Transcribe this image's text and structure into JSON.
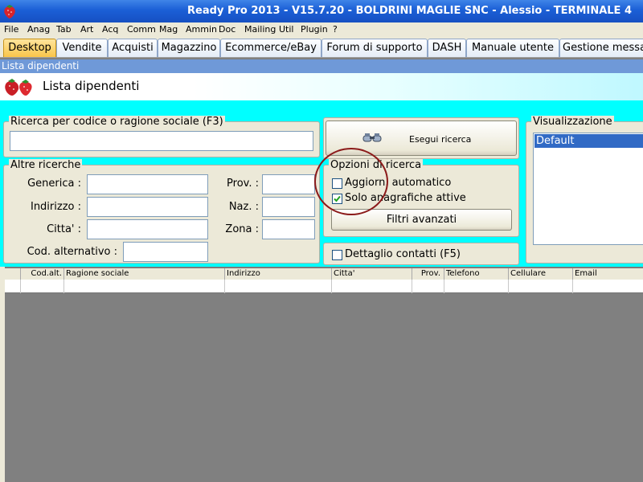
{
  "window": {
    "title": "Ready Pro 2013 - V15.7.20 - BOLDRINI MAGLIE SNC - Alessio - TERMINALE 4"
  },
  "menu": [
    "File",
    "Anag",
    "Tab",
    "Art",
    "Acq",
    "Comm",
    "Mag",
    "Ammin",
    "Doc",
    "Mailing",
    "Util",
    "Plugin",
    "?"
  ],
  "tabs": [
    "Desktop",
    "Vendite",
    "Acquisti",
    "Magazzino",
    "Ecommerce/eBay",
    "Forum di supporto",
    "DASH",
    "Manuale utente",
    "Gestione messa"
  ],
  "active_tab": "Desktop",
  "panel": {
    "caption": "Lista dipendenti",
    "title": "Lista dipendenti"
  },
  "search": {
    "group_label": "Ricerca per codice o ragione sociale (F3)",
    "value": "",
    "search_button": "Esegui ricerca"
  },
  "other_searches": {
    "group_label": "Altre ricerche",
    "fields": {
      "generica": "Generica :",
      "indirizzo": "Indirizzo :",
      "citta": "Citta' :",
      "cod_alt": "Cod. alternativo :",
      "prov": "Prov. :",
      "naz": "Naz. :",
      "zona": "Zona :"
    }
  },
  "options": {
    "group_label": "Opzioni di ricerca",
    "auto_update": {
      "label": "Aggiorn. automatico",
      "checked": false
    },
    "active_only": {
      "label": "Solo anagrafiche attive",
      "checked": true
    },
    "advanced_filters": "Filtri avanzati",
    "contact_detail": {
      "label": "Dettaglio contatti (F5)",
      "checked": false
    }
  },
  "view": {
    "group_label": "Visualizzazione",
    "items": [
      "Default"
    ],
    "selected": "Default"
  },
  "grid": {
    "columns": [
      "Cod.alt.",
      "Ragione sociale",
      "Indirizzo",
      "Citta'",
      "Prov.",
      "Telefono",
      "Cellulare",
      "Email"
    ]
  },
  "colors": {
    "accent_cyan": "#00ffff",
    "title_blue": "#1b5fd6",
    "selection_blue": "#316ac5",
    "annotation_red": "#8b1a1a"
  }
}
